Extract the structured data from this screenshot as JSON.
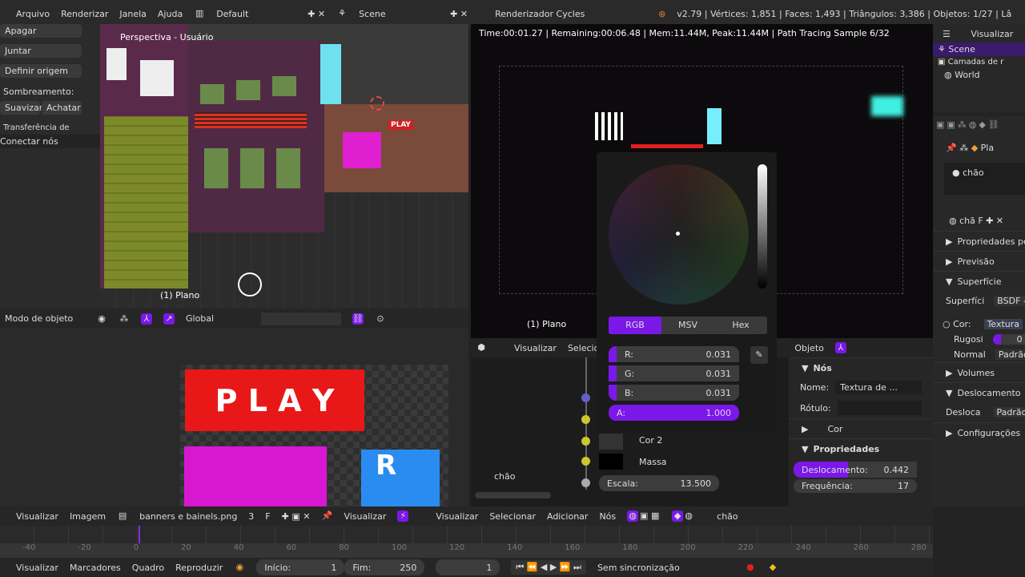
{
  "topbar": {
    "menus": [
      "Arquivo",
      "Renderizar",
      "Janela",
      "Ajuda"
    ],
    "layout": "Default",
    "scene": "Scene",
    "engine": "Renderizador Cycles",
    "stats": "v2.79 | Vértices: 1,851 | Faces: 1,493 | Triângulos: 3,386 | Objetos: 1/27 | Lâ"
  },
  "tools": {
    "delete": "Apagar",
    "join": "Juntar",
    "set_origin": "Definir origem",
    "shading_label": "Sombreamento:",
    "smooth": "Suavizar",
    "flat": "Achatar",
    "transfer": "Transferência de",
    "connect_nodes": "Conectar nós"
  },
  "viewport": {
    "title": "Perspectiva - Usuário",
    "object": "(1) Plano",
    "mode": "Modo de objeto",
    "orientation": "Global",
    "play_sign": "PLAY"
  },
  "render": {
    "status": "Time:00:01.27 | Remaining:00:06.48 | Mem:11.44M, Peak:11.44M | Path Tracing Sample 6/32",
    "object": "(1) Plano"
  },
  "color_picker": {
    "tabs": [
      "RGB",
      "MSV",
      "Hex"
    ],
    "active_tab": "RGB",
    "r_label": "R:",
    "r": "0.031",
    "g_label": "G:",
    "g": "0.031",
    "b_label": "B:",
    "b": "0.031",
    "a_label": "A:",
    "a": "1.000"
  },
  "node_editor": {
    "header": [
      "Visualizar",
      "Selecio"
    ],
    "object_menu": "Objeto",
    "material": "chão",
    "cor2": "Cor 2",
    "massa": "Massa",
    "escala_label": "Escala:",
    "escala": "13.500",
    "npanel": {
      "nodes_title": "Nós",
      "name_label": "Nome:",
      "name_value": "Textura de ...",
      "label_label": "Rótulo:",
      "cor": "Cor",
      "props_title": "Propriedades",
      "displacement_label": "Deslocamento:",
      "displacement": "0.442",
      "displacement_fraction": 0.442,
      "frequency_label": "Frequência:",
      "frequency": "17"
    }
  },
  "image_editor": {
    "play_text": "P L A Y",
    "header": [
      "Visualizar",
      "Imagem"
    ],
    "image_name": "banners e bainels.png",
    "users": "3",
    "fake": "F",
    "view": "Visualizar"
  },
  "node_header": {
    "menus": [
      "Visualizar",
      "Selecionar",
      "Adicionar",
      "Nós"
    ],
    "material": "chão"
  },
  "outliner": {
    "view": "Visualizar",
    "items": [
      "Scene",
      "Camadas de r",
      "World"
    ]
  },
  "properties": {
    "object": "Pla",
    "material_slot": "chão",
    "material_name": "chã",
    "fake": "F",
    "panels": {
      "custom": "Propriedades pers",
      "preview": "Previsão",
      "surface": "Superfície",
      "volumes": "Volumes",
      "displacement": "Deslocamento",
      "settings": "Configurações"
    },
    "surface_label": "Superfíci",
    "surface_value": "BSDF -",
    "color_label": "Cor:",
    "color_value": "Textura",
    "roughness_label": "Rugosi",
    "roughness_value": "0",
    "normal_label": "Normal",
    "normal_value": "Padrão",
    "disp_label": "Desloca",
    "disp_value": "Padrão"
  },
  "timeline": {
    "ticks": [
      "-40",
      "-20",
      "0",
      "20",
      "40",
      "60",
      "80",
      "100",
      "120",
      "140",
      "160",
      "180",
      "200",
      "220",
      "240",
      "260",
      "280"
    ],
    "menus": [
      "Visualizar",
      "Marcadores",
      "Quadro",
      "Reproduzir"
    ],
    "start_label": "Início:",
    "start": "1",
    "end_label": "Fim:",
    "end": "250",
    "current": "1",
    "sync": "Sem sincronização"
  }
}
